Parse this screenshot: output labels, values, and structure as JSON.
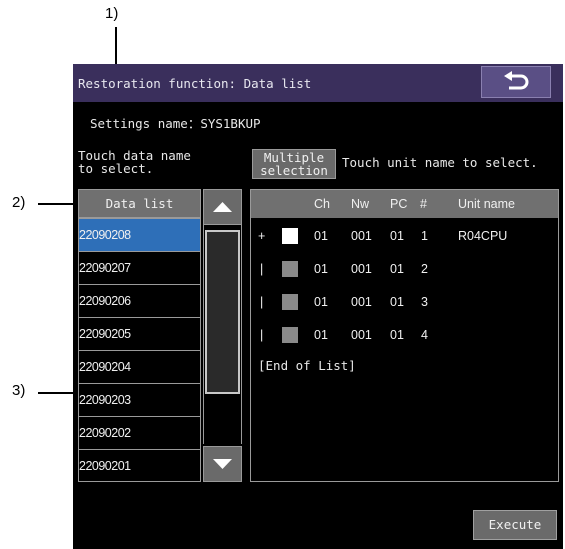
{
  "callouts": {
    "c1": "1)",
    "c2": "2)",
    "c3": "3)"
  },
  "title": "Restoration function: Data list",
  "settings_name": "Settings name：SYS1BKUP",
  "instruction_left_1": "Touch data name",
  "instruction_left_2": "to select.",
  "multiple_selection_1": "Multiple",
  "multiple_selection_2": "selection",
  "instruction_right": "Touch unit name to select.",
  "data_list": {
    "header": "Data list",
    "items": [
      "22090208",
      "22090207",
      "22090206",
      "22090205",
      "22090204",
      "22090203",
      "22090202",
      "22090201"
    ],
    "selected_index": 0
  },
  "unit_table": {
    "headers": {
      "ch": "Ch",
      "nw": "Nw",
      "pc": "PC",
      "num": "#",
      "unit": "Unit name"
    },
    "rows": [
      {
        "tree": "+",
        "ch": "01",
        "nw": "001",
        "pc": "01",
        "num": "1",
        "unit": "R04CPU",
        "checked": true
      },
      {
        "tree": "|",
        "ch": "01",
        "nw": "001",
        "pc": "01",
        "num": "2",
        "unit": "",
        "checked": false
      },
      {
        "tree": "|",
        "ch": "01",
        "nw": "001",
        "pc": "01",
        "num": "3",
        "unit": "",
        "checked": false
      },
      {
        "tree": "|",
        "ch": "01",
        "nw": "001",
        "pc": "01",
        "num": "4",
        "unit": "",
        "checked": false
      }
    ],
    "end_label": "[End of List]"
  },
  "execute_label": "Execute",
  "icons": {
    "back": "back-arrow-icon",
    "up": "triangle-up-icon",
    "down": "triangle-down-icon"
  },
  "colors": {
    "titlebar": "#3a2f5c",
    "selected": "#2e6fb8",
    "button": "#6a6a6a"
  }
}
